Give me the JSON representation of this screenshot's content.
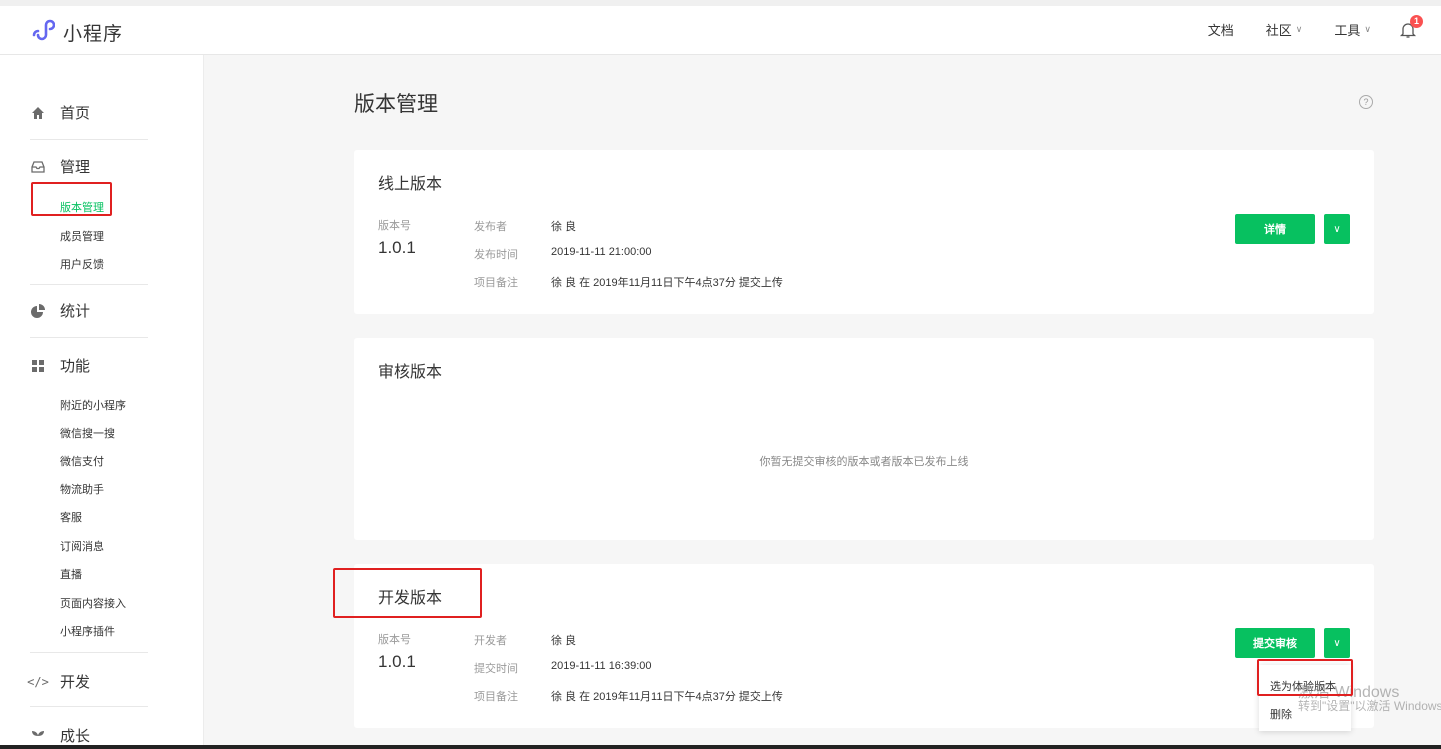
{
  "header": {
    "app_name": "小程序",
    "nav": [
      {
        "label": "文档",
        "dropdown": false
      },
      {
        "label": "社区",
        "dropdown": true
      },
      {
        "label": "工具",
        "dropdown": true
      }
    ],
    "notification_count": "1",
    "accent_color": "#07c160"
  },
  "sidebar": {
    "home": "首页",
    "manage": "管理",
    "manage_items": [
      "版本管理",
      "成员管理",
      "用户反馈"
    ],
    "stats": "统计",
    "features": "功能",
    "feature_items": [
      "附近的小程序",
      "微信搜一搜",
      "微信支付",
      "物流助手",
      "客服",
      "订阅消息",
      "直播",
      "页面内容接入",
      "小程序插件"
    ],
    "dev": "开发",
    "growth": "成长"
  },
  "main": {
    "title": "版本管理",
    "online": {
      "title": "线上版本",
      "version_label": "版本号",
      "version": "1.0.1",
      "publisher_label": "发布者",
      "publisher": "徐 良",
      "time_label": "发布时间",
      "time": "2019-11-11 21:00:00",
      "note_label": "项目备注",
      "note": "徐 良 在 2019年11月11日下午4点37分 提交上传",
      "button": "详情"
    },
    "review": {
      "title": "审核版本",
      "empty_text": "你暂无提交审核的版本或者版本已发布上线"
    },
    "dev": {
      "title": "开发版本",
      "version_label": "版本号",
      "version": "1.0.1",
      "developer_label": "开发者",
      "developer": "徐 良",
      "time_label": "提交时间",
      "time": "2019-11-11 16:39:00",
      "note_label": "项目备注",
      "note": "徐 良 在 2019年11月11日下午4点37分 提交上传",
      "button": "提交审核",
      "menu": [
        "选为体验版本",
        "删除"
      ]
    }
  },
  "watermark": {
    "line1": "激活 Windows",
    "line2": "转到\"设置\"以激活 Windows"
  }
}
